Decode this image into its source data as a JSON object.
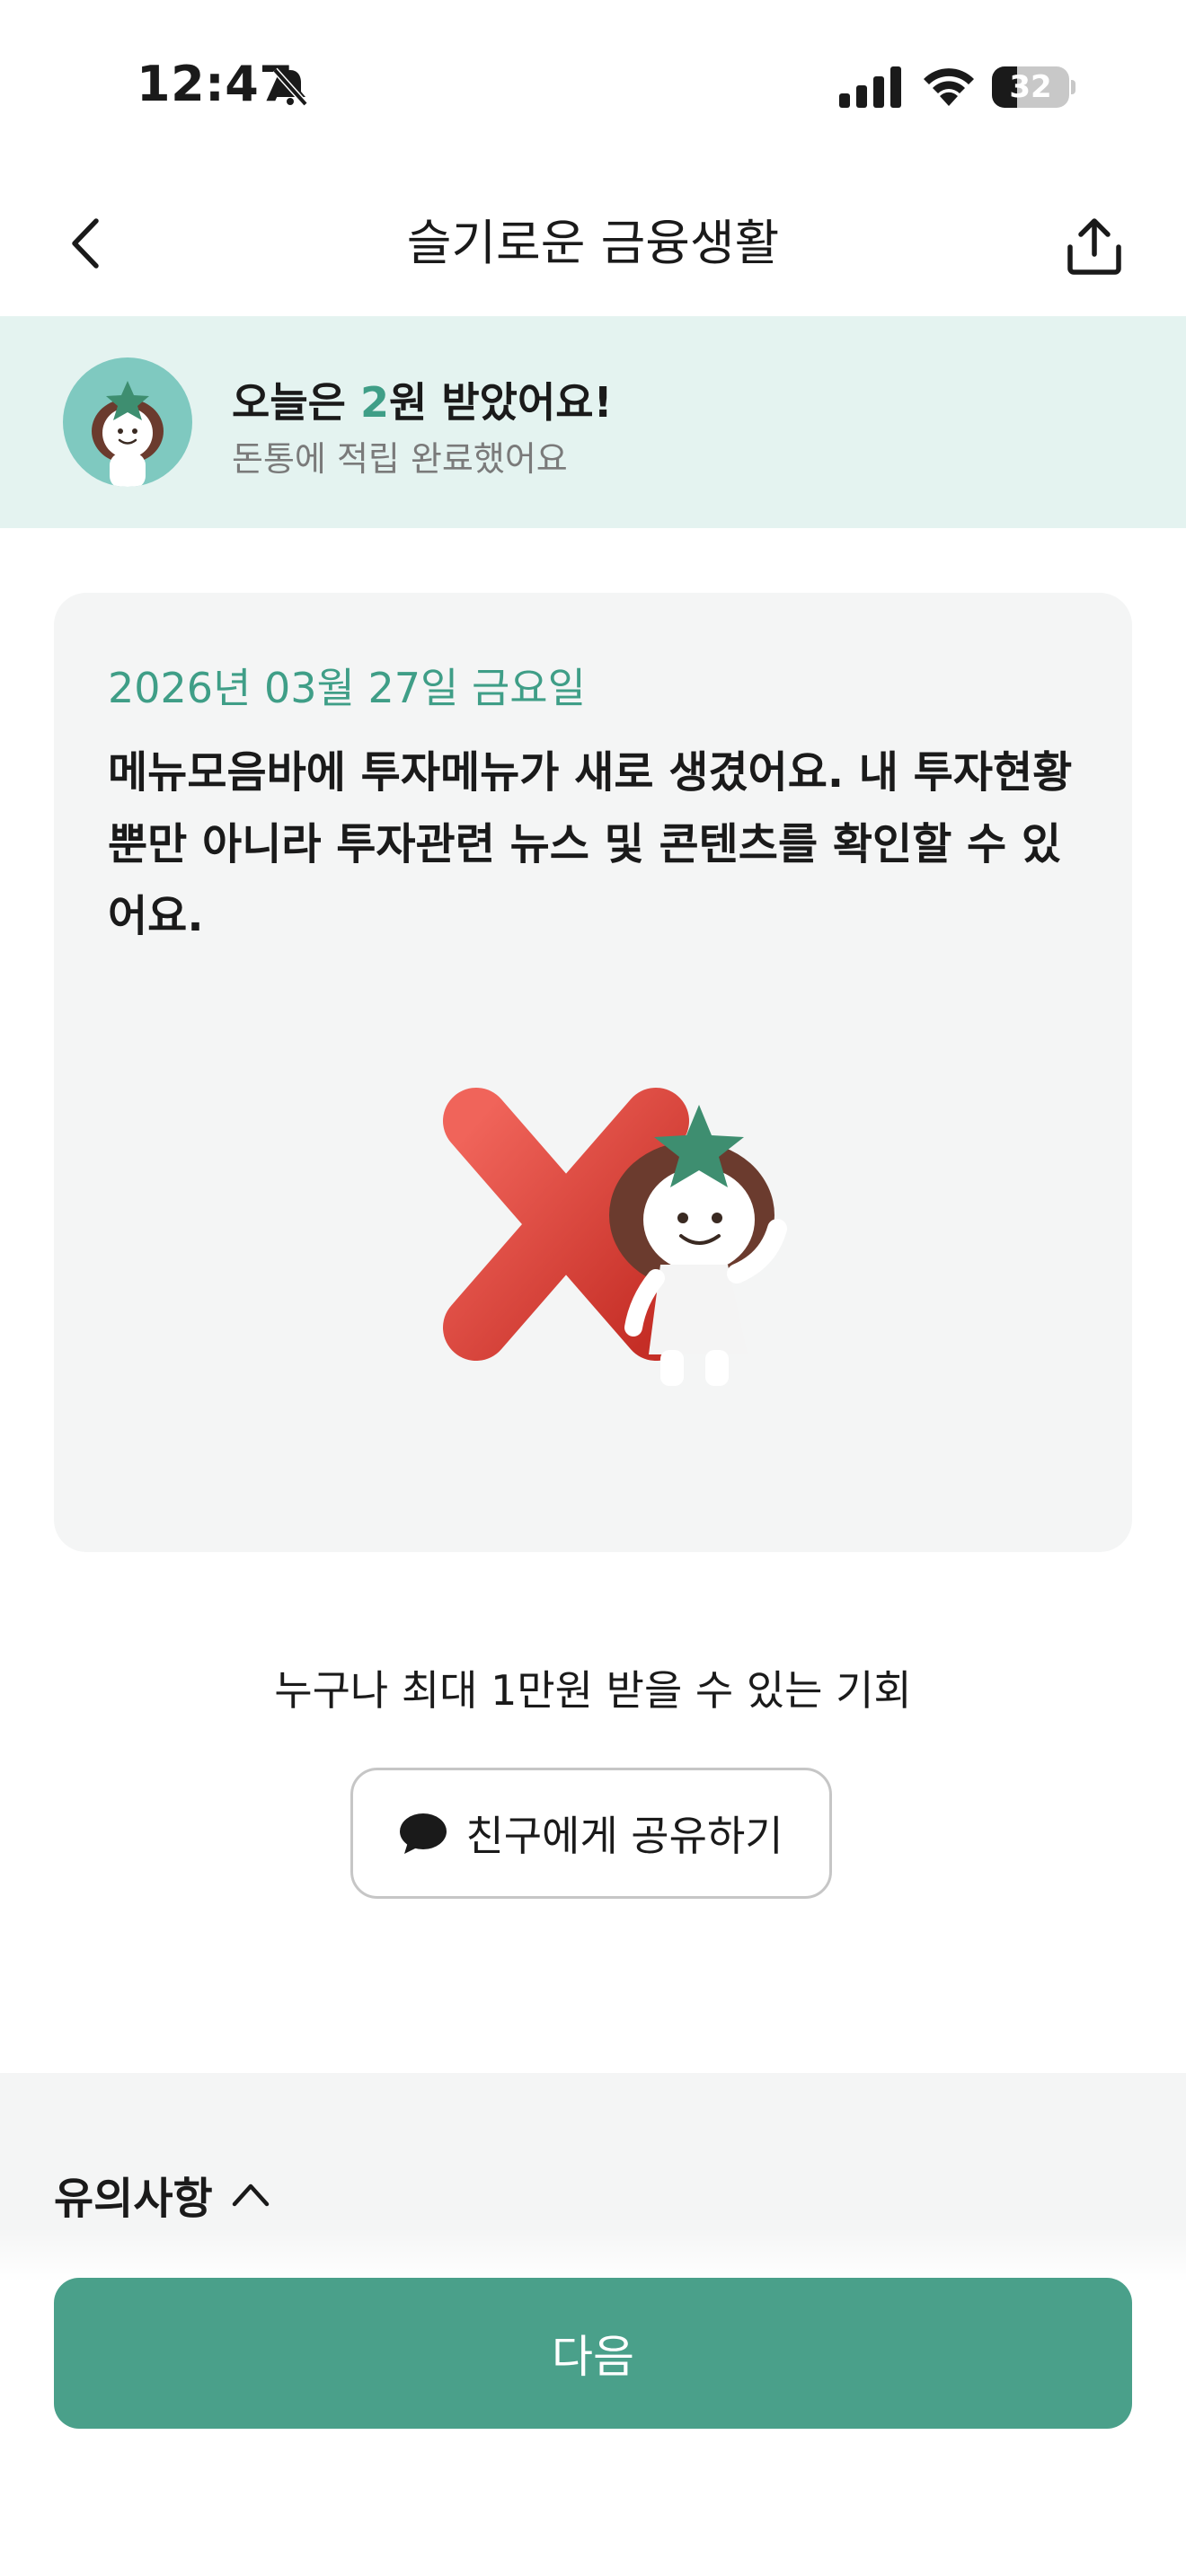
{
  "status_bar": {
    "time": "12:47",
    "battery_percent": 32,
    "battery_text": "32",
    "icons": [
      "bell-slash-icon",
      "signal-icon",
      "wifi-icon",
      "battery-icon"
    ]
  },
  "nav": {
    "title": "슬기로운 금융생활",
    "back_icon": "chevron-left-icon",
    "share_icon": "share-upload-icon"
  },
  "reward": {
    "title_prefix": "오늘은 ",
    "amount": "2",
    "title_suffix": "원 받았어요!",
    "subtitle": "돈통에 적립 완료했어요"
  },
  "card": {
    "date": "2026년 03월 27일 금요일",
    "message": "메뉴모음바에 투자메뉴가 새로 생겼어요. 내 투자현황뿐만 아니라 투자관련 뉴스 및 콘텐츠를 확인할 수 있어요.",
    "illustration": "red-x-mascot"
  },
  "promo": {
    "text": "누구나 최대 1만원 받을 수 있는 기회",
    "share_button_label": "친구에게 공유하기",
    "share_button_icon": "chat-bubble-icon"
  },
  "notice": {
    "label": "유의사항",
    "icon": "chevron-up-icon"
  },
  "next_button": {
    "label": "다음"
  },
  "colors": {
    "accent": "#3f9e87",
    "primary_button": "#4aa08a",
    "banner_bg": "#e4f3f0",
    "card_bg": "#f4f5f5"
  }
}
